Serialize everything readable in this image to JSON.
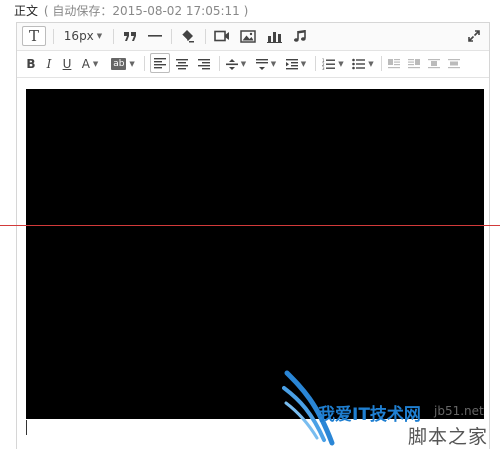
{
  "header": {
    "title": "正文",
    "autosave": "( 自动保存：2015-08-02 17:05:11 )"
  },
  "toolbar1": {
    "text_style_label": "T",
    "font_size": "16px"
  },
  "toolbar2": {
    "bold": "B",
    "italic": "I",
    "underline": "U",
    "font_color": "A",
    "highlight": "ab"
  },
  "watermark": {
    "brand": "我爱IT技术网",
    "domain": "jb51.net",
    "site": "脚本之家"
  }
}
